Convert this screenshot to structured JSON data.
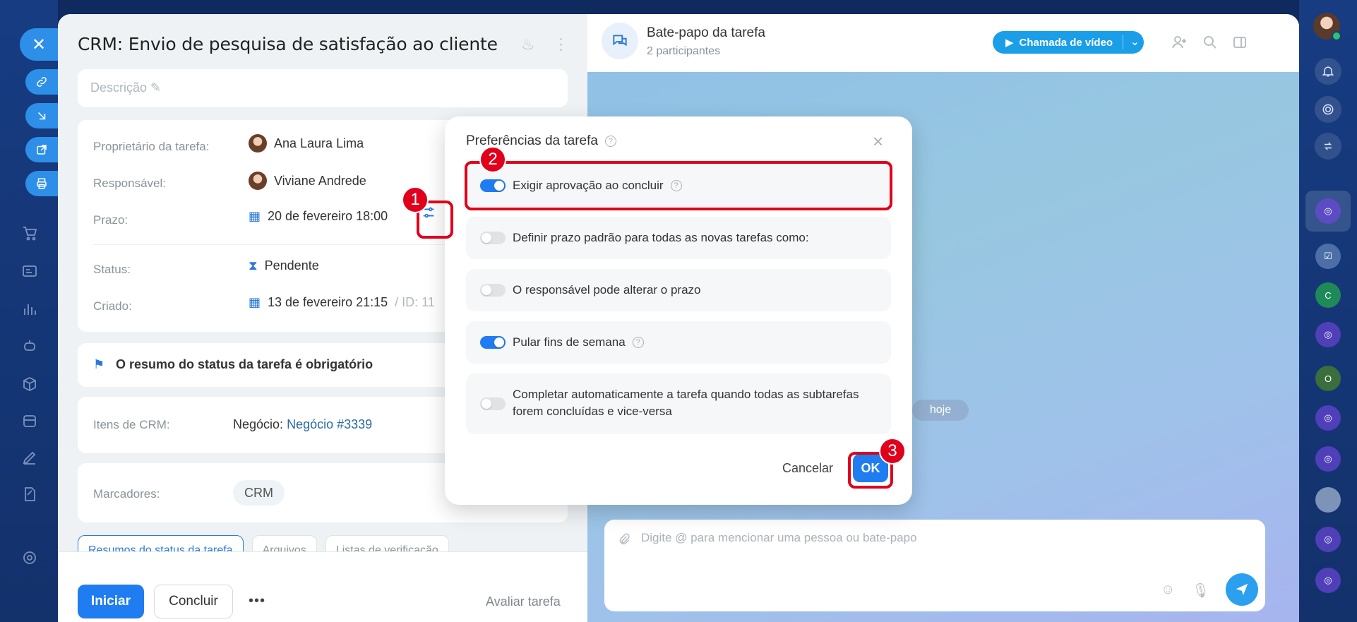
{
  "task": {
    "title": "CRM: Envio de pesquisa de satisfação ao cliente",
    "description_placeholder": "Descrição",
    "fields": {
      "owner_label": "Proprietário da tarefa:",
      "owner_value": "Ana Laura Lima",
      "responsible_label": "Responsável:",
      "responsible_value": "Viviane Andrede",
      "deadline_label": "Prazo:",
      "deadline_value": "20 de fevereiro 18:00",
      "status_label": "Status:",
      "status_value": "Pendente",
      "created_label": "Criado:",
      "created_value": "13 de fevereiro 21:15",
      "id_text": "/ ID: 11"
    },
    "status_summary": "O resumo do status da tarefa é obrigatório",
    "crm": {
      "label": "Itens de CRM:",
      "prefix": "Negócio:",
      "link": "Negócio #3339"
    },
    "tags": {
      "label": "Marcadores:",
      "value": "CRM"
    },
    "tabs": [
      "Resumos do status da tarefa",
      "Arquivos",
      "Listas de verificação"
    ],
    "buttons": {
      "start": "Iniciar",
      "complete": "Concluir",
      "more": "•••",
      "rate": "Avaliar tarefa"
    }
  },
  "chat": {
    "title": "Bate-papo da tarefa",
    "subtitle": "2 participantes",
    "video_button": "Chamada de vídeo",
    "date_pill": "hoje",
    "composer_placeholder": "Digite @ para mencionar uma pessoa ou bate-papo"
  },
  "modal": {
    "title": "Preferências da tarefa",
    "options": [
      {
        "label": "Exigir aprovação ao concluir",
        "enabled": true,
        "help": true
      },
      {
        "label": "Definir prazo padrão para todas as novas tarefas como:",
        "enabled": false,
        "help": false
      },
      {
        "label": "O responsável pode alterar o prazo",
        "enabled": false,
        "help": false
      },
      {
        "label": "Pular fins de semana",
        "enabled": true,
        "help": true
      },
      {
        "label": "Completar automaticamente a tarefa quando todas as subtarefas forem concluídas e vice-versa",
        "enabled": false,
        "help": false
      }
    ],
    "cancel": "Cancelar",
    "ok": "OK"
  },
  "annotations": [
    "1",
    "2",
    "3"
  ],
  "right_nav": {
    "chat_initials": [
      "C",
      "O"
    ]
  },
  "colors": {
    "accent": "#1f7cf1",
    "annotation": "#e0001b",
    "nav_background": "#173c82"
  }
}
